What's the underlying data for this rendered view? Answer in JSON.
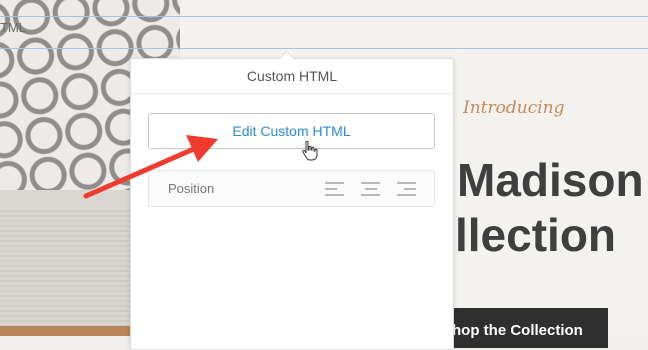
{
  "background": {
    "introducing": "Introducing",
    "title_line1": "Madison",
    "title_line2": "llection",
    "shop_button": "hop the Collection",
    "crumb": "TML"
  },
  "popover": {
    "header": "Custom HTML",
    "edit_button": "Edit Custom HTML",
    "position_label": "Position",
    "alignment_options": [
      "align-left-icon",
      "align-center-icon",
      "align-right-icon"
    ]
  },
  "annotation": {
    "arrow_color": "#f03b2f"
  },
  "colors": {
    "link_blue": "#2b8ad9",
    "guide_blue": "#9cc6ea",
    "accent_orange": "#c78a5a",
    "title_gray": "#3f3f3f"
  }
}
